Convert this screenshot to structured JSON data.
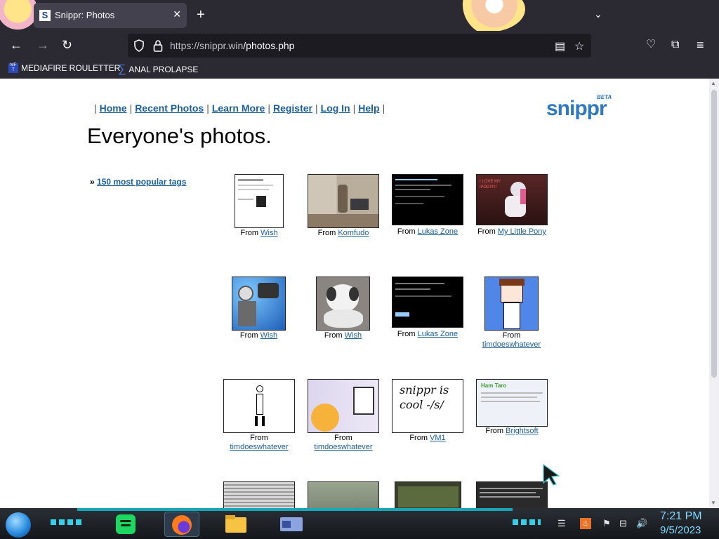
{
  "browser": {
    "tab_title": "Snippr: Photos",
    "tab_favicon": "S",
    "url_host": "https://snippr.win",
    "url_path": "/photos.php",
    "bookmarks": [
      {
        "label": "MEDIAFIRE ROULETTER",
        "icon": "MF T"
      },
      {
        "label": "ANAL PROLAPSE",
        "icon": "sigma-icon"
      }
    ]
  },
  "page": {
    "nav": [
      "Home",
      "Recent Photos",
      "Learn More",
      "Register",
      "Log In",
      "Help"
    ],
    "logo": "snippr",
    "logo_badge": "BETA",
    "heading": "Everyone's photos.",
    "tags_link": "150 most popular tags",
    "tags_bullet": "»",
    "from_label": "From",
    "photos": [
      {
        "source": "Wish",
        "kind": "screenshot-light"
      },
      {
        "source": "Komfudo",
        "kind": "photo-room"
      },
      {
        "source": "Lukas Zone",
        "kind": "screenshot-dark"
      },
      {
        "source": "My Little Pony",
        "kind": "photo-pony",
        "caption_text": "I LOVE MY iPOD!!!!!!"
      },
      {
        "source": "Wish",
        "kind": "art-astronaut"
      },
      {
        "source": "Wish",
        "kind": "photo-dog"
      },
      {
        "source": "Lukas Zone",
        "kind": "screenshot-dark"
      },
      {
        "source": "timdoeswhatever",
        "kind": "drawing-character"
      },
      {
        "source": "timdoeswhatever",
        "kind": "drawing-stick"
      },
      {
        "source": "timdoeswhatever",
        "kind": "drawing-emoji"
      },
      {
        "source": "VM1",
        "kind": "handwriting",
        "caption_text": "snippr is cool -/s/"
      },
      {
        "source": "Brightsoft",
        "kind": "screenshot-hamtaro",
        "caption_text": "Ham Taro"
      },
      {
        "source": "",
        "kind": "photo-fridge"
      },
      {
        "source": "",
        "kind": "photo-outdoor"
      },
      {
        "source": "",
        "kind": "screenshot-game"
      },
      {
        "source": "",
        "kind": "screenshot-terminal"
      }
    ]
  },
  "taskbar": {
    "time": "7:21 PM",
    "date": "9/5/2023",
    "apps": [
      "spotify-icon",
      "firefox-icon",
      "file-explorer-icon",
      "window-app-icon"
    ]
  },
  "colors": {
    "link": "#1a5e9a",
    "chrome": "#2b2a33",
    "accent": "#16a6b8"
  }
}
